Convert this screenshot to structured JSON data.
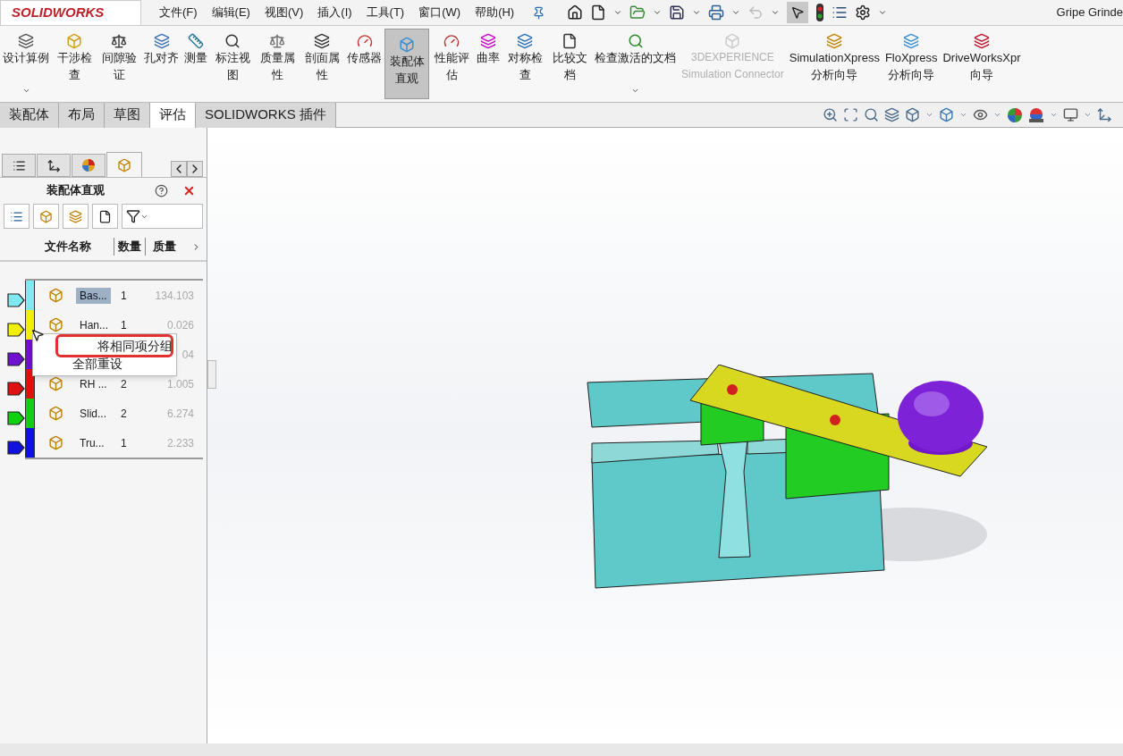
{
  "app": {
    "logo": "SOLIDWORKS",
    "document_title": "Gripe Grinde"
  },
  "menu": [
    "文件(F)",
    "编辑(E)",
    "视图(V)",
    "插入(I)",
    "工具(T)",
    "窗口(W)",
    "帮助(H)"
  ],
  "ribbon": [
    {
      "label": "设计算例",
      "kind": "plain",
      "selected": false,
      "disabled": false,
      "dropdown": true
    },
    {
      "label": "干涉检查",
      "kind": "stacked",
      "selected": false,
      "disabled": false,
      "dropdown": false
    },
    {
      "label": "间隙验证",
      "kind": "stacked",
      "selected": false,
      "disabled": false,
      "dropdown": false
    },
    {
      "label": "孔对齐",
      "kind": "plain",
      "selected": false,
      "disabled": false,
      "dropdown": false
    },
    {
      "label": "测量",
      "kind": "plain",
      "selected": false,
      "disabled": false,
      "dropdown": false
    },
    {
      "label": "标注视图",
      "kind": "stacked",
      "selected": false,
      "disabled": false,
      "dropdown": false
    },
    {
      "label": "质量属性",
      "kind": "stacked",
      "selected": false,
      "disabled": false,
      "dropdown": false
    },
    {
      "label": "剖面属性",
      "kind": "stacked",
      "selected": false,
      "disabled": false,
      "dropdown": false
    },
    {
      "label": "传感器",
      "kind": "plain",
      "selected": false,
      "disabled": false,
      "dropdown": false
    },
    {
      "label": "装配体直观",
      "kind": "stacked",
      "selected": true,
      "disabled": false,
      "dropdown": false
    },
    {
      "label": "性能评估",
      "kind": "stacked",
      "selected": false,
      "disabled": false,
      "dropdown": false
    },
    {
      "label": "曲率",
      "kind": "plain",
      "selected": false,
      "disabled": false,
      "dropdown": false
    },
    {
      "label": "对称检查",
      "kind": "stacked",
      "selected": false,
      "disabled": false,
      "dropdown": false
    },
    {
      "label": "比较文档",
      "kind": "stacked",
      "selected": false,
      "disabled": false,
      "dropdown": false
    },
    {
      "label": "检查激活的文档",
      "kind": "plain",
      "selected": false,
      "disabled": false,
      "dropdown": true
    },
    {
      "label": "3DEXPERIENCE\nSimulation Connector",
      "kind": "plain",
      "selected": false,
      "disabled": true,
      "dropdown": false
    },
    {
      "label": "SimulationXpress\n分析向导",
      "kind": "plain",
      "selected": false,
      "disabled": false,
      "dropdown": false
    },
    {
      "label": "FloXpress\n分析向导",
      "kind": "plain",
      "selected": false,
      "disabled": false,
      "dropdown": false
    },
    {
      "label": "DriveWorksXpr\n向导",
      "kind": "plain",
      "selected": false,
      "disabled": false,
      "dropdown": false
    }
  ],
  "tabs": [
    {
      "label": "装配体",
      "selected": false
    },
    {
      "label": "布局",
      "selected": false
    },
    {
      "label": "草图",
      "selected": false
    },
    {
      "label": "评估",
      "selected": true
    },
    {
      "label": "SOLIDWORKS 插件",
      "selected": false
    }
  ],
  "panel": {
    "title": "装配体直观",
    "columns": [
      "文件名称",
      "数量",
      "质量"
    ],
    "rows": [
      {
        "name": "Bas...",
        "quantity": "1",
        "mass": "134.103",
        "color": "#80e8f0",
        "selected": true
      },
      {
        "name": "Han...",
        "quantity": "1",
        "mass": "0.026",
        "color": "#f0f000",
        "selected": false
      },
      {
        "mass": "04",
        "color": "#7010d0",
        "selected": false
      },
      {
        "name": "RH ...",
        "quantity": "2",
        "mass": "1.005",
        "color": "#e01010",
        "selected": false
      },
      {
        "name": "Slid...",
        "quantity": "2",
        "mass": "6.274",
        "color": "#10d010",
        "selected": false
      },
      {
        "name": "Tru...",
        "quantity": "1",
        "mass": "2.233",
        "color": "#1010e0",
        "selected": false
      }
    ]
  },
  "context_menu": {
    "items": [
      {
        "label": "将相同项分组",
        "highlighted": true
      },
      {
        "label": "全部重设",
        "highlighted": false
      }
    ]
  }
}
